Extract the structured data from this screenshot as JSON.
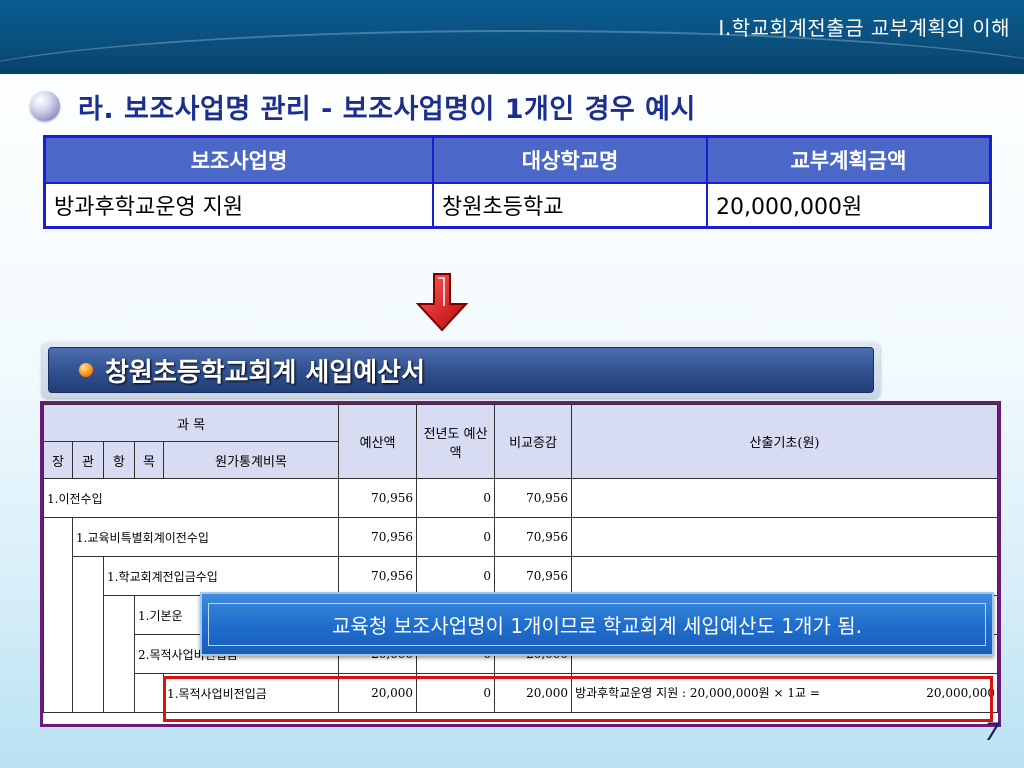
{
  "header": {
    "title": "Ⅰ.학교회계전출금 교부계획의 이해"
  },
  "subtitle": "라. 보조사업명 관리 - 보조사업명이 1개인 경우 예시",
  "summary_table": {
    "headers": [
      "보조사업명",
      "대상학교명",
      "교부계획금액"
    ],
    "row": [
      "방과후학교운영 지원",
      "창원초등학교",
      "20,000,000원"
    ]
  },
  "section": {
    "label": "창원초등학교회계 세입예산서"
  },
  "budget": {
    "headers": {
      "subject": "과 목",
      "jang": "장",
      "gwan": "관",
      "hang": "항",
      "mok": "목",
      "stat": "원가통계비목",
      "budget": "예산액",
      "prev": "전년도 예산액",
      "diff": "비교증감",
      "basis": "산출기초(원)"
    },
    "rows": [
      {
        "name": "1.이전수입",
        "budget": "70,956",
        "prev": "0",
        "diff": "70,956",
        "basis": ""
      },
      {
        "name": "1.교육비특별회계이전수입",
        "budget": "70,956",
        "prev": "0",
        "diff": "70,956",
        "basis": ""
      },
      {
        "name": "1.학교회계전입금수입",
        "budget": "70,956",
        "prev": "0",
        "diff": "70,956",
        "basis": ""
      },
      {
        "name": "1.기본운",
        "budget": "",
        "prev": "",
        "diff": "",
        "basis": ""
      },
      {
        "name": "2.목적사업비전입금",
        "budget": "20,000",
        "prev": "0",
        "diff": "20,000",
        "basis": ""
      },
      {
        "name": "1.목적사업비전입금",
        "budget": "20,000",
        "prev": "0",
        "diff": "20,000",
        "basis": "방과후학교운영 지원 : 20,000,000원 × 1교 =",
        "basis_total": "20,000,000"
      }
    ]
  },
  "callout": "교육청 보조사업명이 1개이므로 학교회계 세입예산도 1개가 됨.",
  "page_number": "7",
  "colors": {
    "header_bg": "#0a4f7c",
    "table_border": "#1a1ed0",
    "highlight": "#e01010",
    "callout_bg": "#1f6fce"
  }
}
